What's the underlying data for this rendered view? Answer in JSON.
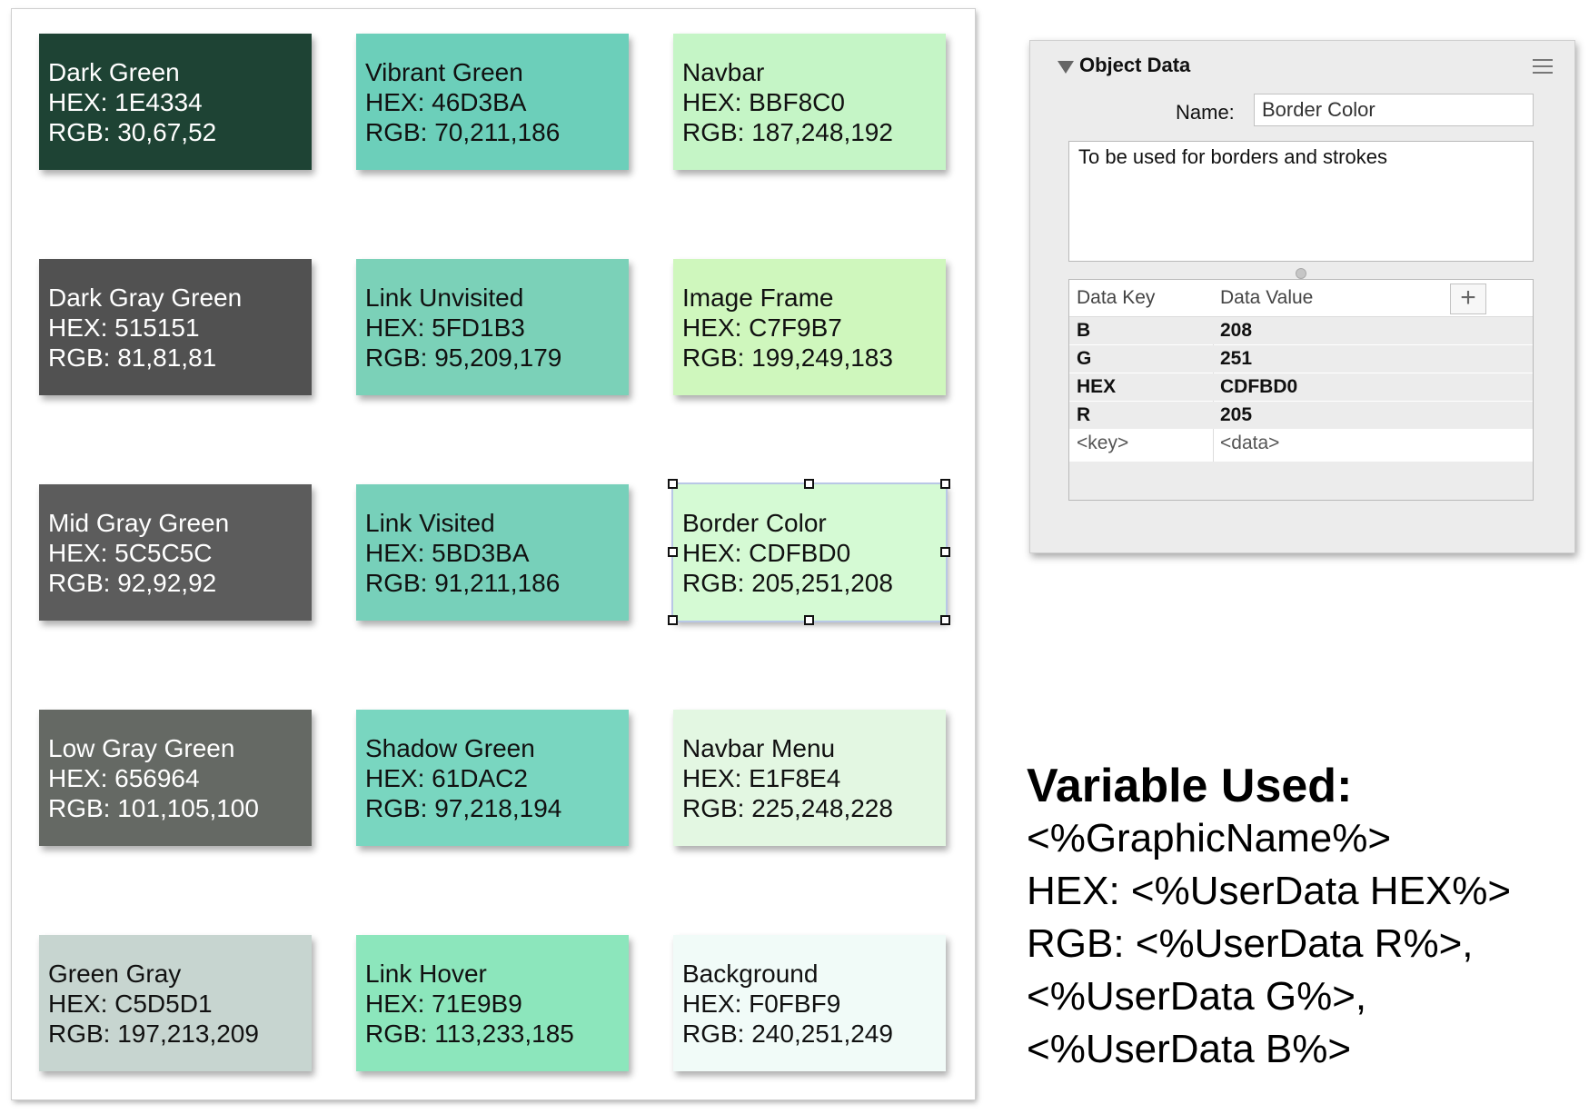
{
  "swatches": [
    {
      "name": "Dark Green",
      "hex": "HEX: 1E4334",
      "rgb": "RGB: 30,67,52",
      "bg": "#1E4334",
      "fg": "#ffffff"
    },
    {
      "name": "Vibrant Green",
      "hex": "HEX: 46D3BA",
      "rgb": "RGB: 70,211,186",
      "bg": "#6CCFBA",
      "fg": "#111111"
    },
    {
      "name": "Navbar",
      "hex": "HEX: BBF8C0",
      "rgb": "RGB: 187,248,192",
      "bg": "#C5F5C6",
      "fg": "#111111"
    },
    {
      "name": "Dark Gray Green",
      "hex": "HEX: 515151",
      "rgb": "RGB: 81,81,81",
      "bg": "#515151",
      "fg": "#ffffff"
    },
    {
      "name": "Link Unvisited",
      "hex": "HEX: 5FD1B3",
      "rgb": "RGB: 95,209,179",
      "bg": "#7BD1B8",
      "fg": "#111111"
    },
    {
      "name": "Image Frame",
      "hex": "HEX: C7F9B7",
      "rgb": "RGB: 199,249,183",
      "bg": "#CFF7BD",
      "fg": "#111111"
    },
    {
      "name": "Mid Gray Green",
      "hex": "HEX: 5C5C5C",
      "rgb": "RGB: 92,92,92",
      "bg": "#5C5C5C",
      "fg": "#ffffff"
    },
    {
      "name": "Link Visited",
      "hex": "HEX: 5BD3BA",
      "rgb": "RGB: 91,211,186",
      "bg": "#77D0BA",
      "fg": "#111111"
    },
    {
      "name": "Border Color",
      "hex": "HEX: CDFBD0",
      "rgb": "RGB: 205,251,208",
      "bg": "#D5FAD4",
      "fg": "#111111"
    },
    {
      "name": "Low Gray Green",
      "hex": "HEX: 656964",
      "rgb": "RGB: 101,105,100",
      "bg": "#656964",
      "fg": "#ffffff"
    },
    {
      "name": "Shadow Green",
      "hex": "HEX: 61DAC2",
      "rgb": "RGB: 97,218,194",
      "bg": "#79D6C0",
      "fg": "#111111"
    },
    {
      "name": "Navbar Menu",
      "hex": "HEX: E1F8E4",
      "rgb": "RGB: 225,248,228",
      "bg": "#E3F7E2",
      "fg": "#111111"
    },
    {
      "name": "Green Gray",
      "hex": "HEX: C5D5D1",
      "rgb": "RGB: 197,213,209",
      "bg": "#C7D5D0",
      "fg": "#111111"
    },
    {
      "name": "Link Hover",
      "hex": "HEX: 71E9B9",
      "rgb": "RGB: 113,233,185",
      "bg": "#8CE6BC",
      "fg": "#111111"
    },
    {
      "name": "Background",
      "hex": "HEX: F0FBF9",
      "rgb": "RGB: 240,251,249",
      "bg": "#F1FBF8",
      "fg": "#111111"
    }
  ],
  "inspector": {
    "title": "Object Data",
    "name_label": "Name:",
    "name_value": "Border Color",
    "notes": "To be used for borders and strokes",
    "col_key": "Data Key",
    "col_value": "Data Value",
    "add_label": "+",
    "rows": [
      {
        "key": "B",
        "value": "208"
      },
      {
        "key": "G",
        "value": "251"
      },
      {
        "key": "HEX",
        "value": "CDFBD0"
      },
      {
        "key": "R",
        "value": "205"
      }
    ],
    "placeholder_key": "<key>",
    "placeholder_value": "<data>"
  },
  "variables": {
    "title": "Variable Used:",
    "lines": [
      "<%GraphicName%>",
      "HEX: <%UserData HEX%>",
      "RGB: <%UserData R%>,",
      "<%UserData G%>,",
      "<%UserData B%>"
    ]
  },
  "colors": {
    "panel_bg": "#ececec",
    "selection": "#b9c7e6"
  }
}
